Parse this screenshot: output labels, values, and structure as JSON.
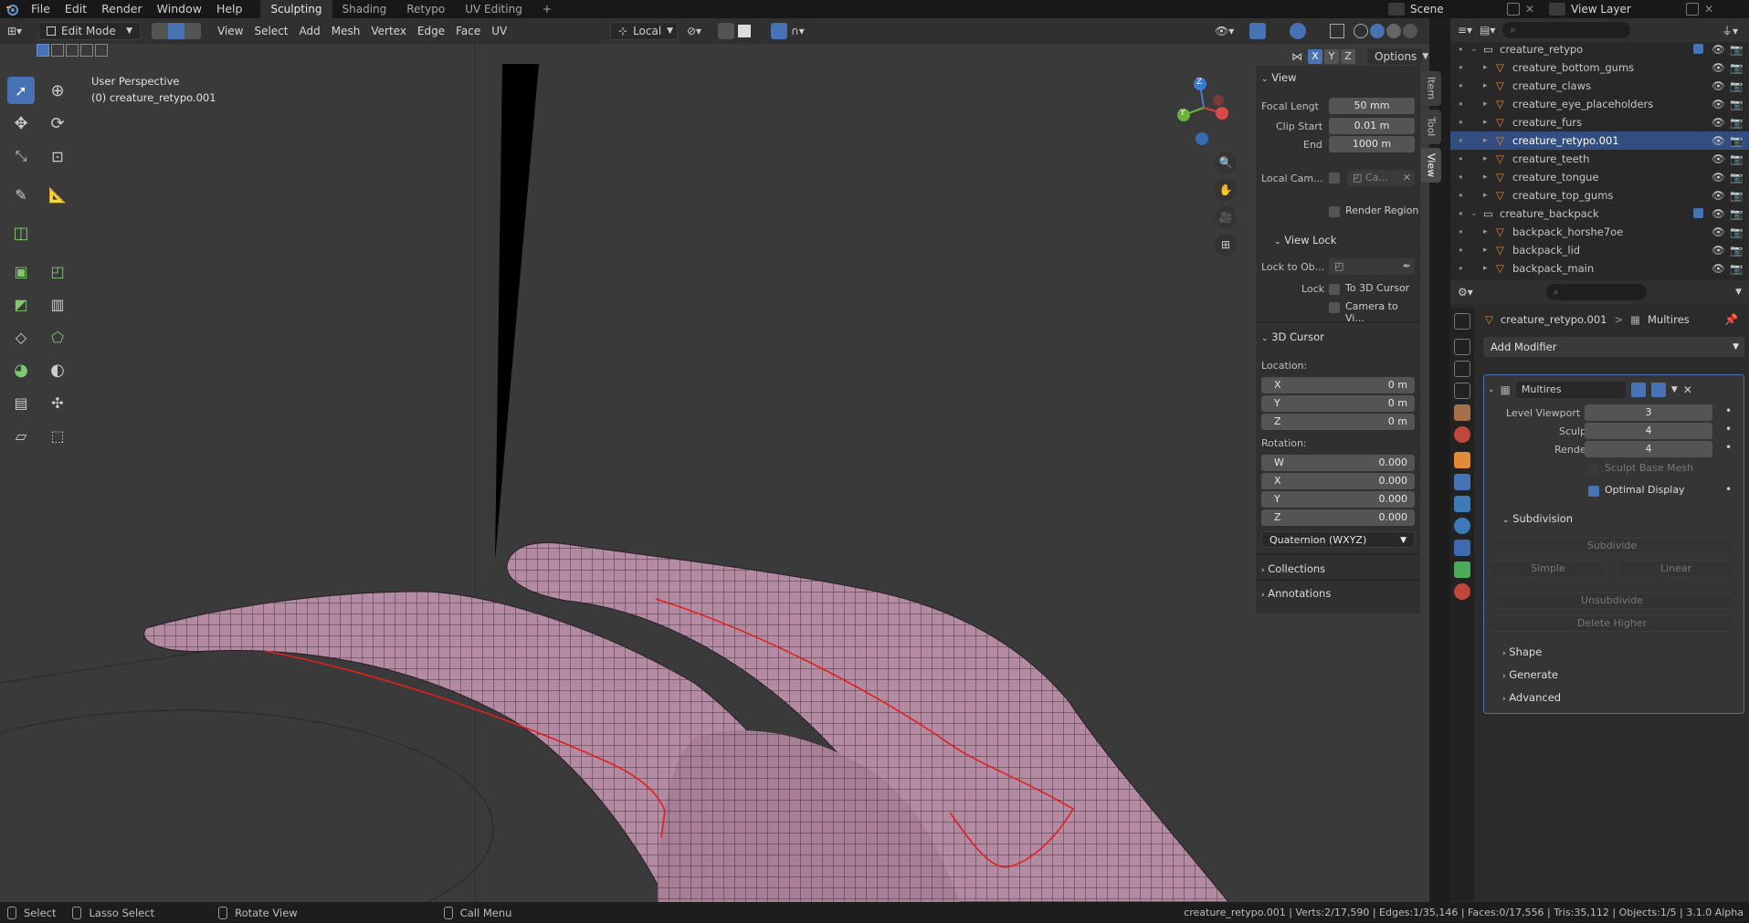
{
  "topbar": {
    "menus": [
      "File",
      "Edit",
      "Render",
      "Window",
      "Help"
    ],
    "workspaces": [
      "Sculpting",
      "Shading",
      "Retypo",
      "UV Editing"
    ],
    "active_workspace": "Sculpting",
    "add_tab": "+",
    "scene_label": "Scene",
    "view_layer_label": "View Layer"
  },
  "header": {
    "mode": "Edit Mode",
    "menus": [
      "View",
      "Select",
      "Add",
      "Mesh",
      "Vertex",
      "Edge",
      "Face",
      "UV"
    ],
    "transform_orientation": "Local",
    "options_label": "Options",
    "axis_buttons": [
      "X",
      "Y",
      "Z"
    ]
  },
  "viewport": {
    "perspective": "User Perspective",
    "object": "(0) creature_retypo.001",
    "gizmo": {
      "x": "X",
      "y": "Y",
      "z": "Z"
    }
  },
  "npanel": {
    "tabs": [
      "Item",
      "Tool",
      "View"
    ],
    "active_tab": "View",
    "view_section": "View",
    "focal_label": "Focal Lengt",
    "focal_value": "50 mm",
    "clip_start_label": "Clip Start",
    "clip_start_value": "0.01 m",
    "end_label": "End",
    "end_value": "1000 m",
    "local_cam_label": "Local Cam...",
    "local_cam_value": "Ca...",
    "render_region": "Render Region",
    "view_lock": "View Lock",
    "lock_to_obj": "Lock to Ob...",
    "lock_label": "Lock",
    "to_3d_cursor": "To 3D Cursor",
    "camera_to_view": "Camera to Vi...",
    "cursor_section": "3D Cursor",
    "location_label": "Location:",
    "loc_x_label": "X",
    "loc_x": "0 m",
    "loc_y_label": "Y",
    "loc_y": "0 m",
    "loc_z_label": "Z",
    "loc_z": "0 m",
    "rotation_label": "Rotation:",
    "rot_w_label": "W",
    "rot_w": "0.000",
    "rot_x_label": "X",
    "rot_x": "0.000",
    "rot_y_label": "Y",
    "rot_y": "0.000",
    "rot_z_label": "Z",
    "rot_z": "0.000",
    "rot_mode": "Quaternion (WXYZ)",
    "collections": "Collections",
    "annotations": "Annotations"
  },
  "outliner": {
    "rows": [
      {
        "name": "creature_retypo",
        "type": "collection",
        "selected": false
      },
      {
        "name": "creature_bottom_gums",
        "type": "object",
        "selected": false
      },
      {
        "name": "creature_claws",
        "type": "object",
        "selected": false
      },
      {
        "name": "creature_eye_placeholders",
        "type": "object",
        "selected": false
      },
      {
        "name": "creature_furs",
        "type": "object",
        "selected": false
      },
      {
        "name": "creature_retypo.001",
        "type": "object",
        "selected": true
      },
      {
        "name": "creature_teeth",
        "type": "object",
        "selected": false
      },
      {
        "name": "creature_tongue",
        "type": "object",
        "selected": false
      },
      {
        "name": "creature_top_gums",
        "type": "object",
        "selected": false
      },
      {
        "name": "creature_backpack",
        "type": "collection",
        "selected": false
      },
      {
        "name": "backpack_horshe7oe",
        "type": "object",
        "selected": false
      },
      {
        "name": "backpack_lid",
        "type": "object",
        "selected": false
      },
      {
        "name": "backpack_main",
        "type": "object",
        "selected": false
      }
    ]
  },
  "properties": {
    "breadcrumb_object": "creature_retypo.001",
    "breadcrumb_sep": ">",
    "breadcrumb_modifier": "Multires",
    "add_modifier": "Add Modifier",
    "modifier_name": "Multires",
    "level_viewport_label": "Level Viewport",
    "level_viewport": "3",
    "sculpt_label": "Sculpt",
    "sculpt": "4",
    "render_label": "Render",
    "render": "4",
    "sculpt_base_mesh": "Sculpt Base Mesh",
    "optimal_display": "Optimal Display",
    "subdivision": "Subdivision",
    "subdivide": "Subdivide",
    "simple": "Simple",
    "linear": "Linear",
    "unsubdivide": "Unsubdivide",
    "delete_higher": "Delete Higher",
    "shape": "Shape",
    "generate": "Generate",
    "advanced": "Advanced"
  },
  "statusbar": {
    "select": "Select",
    "lasso": "Lasso Select",
    "rotate": "Rotate View",
    "call_menu": "Call Menu",
    "stats": "creature_retypo.001 | Verts:2/17,590 | Edges:1/35,146 | Faces:0/17,556 | Tris:35,112 | Objects:1/5 | 3.1.0 Alpha"
  },
  "colors": {
    "accent": "#4772b3",
    "mesh": "#b58aa3",
    "seam": "#e02020",
    "bg": "#3a3a3a"
  }
}
